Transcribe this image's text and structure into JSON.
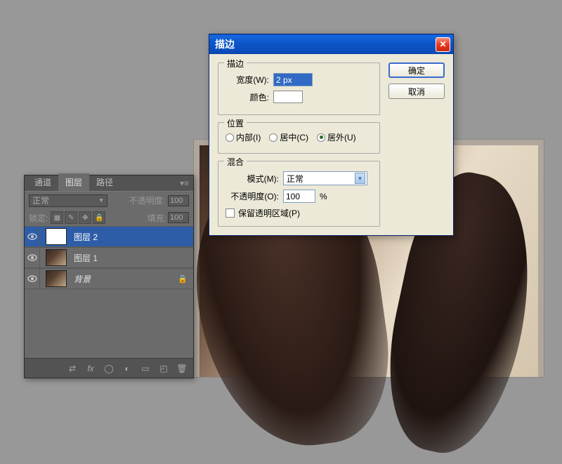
{
  "canvas": {},
  "layers_panel": {
    "tabs": {
      "channels": "通道",
      "layers": "图层",
      "paths": "路径"
    },
    "blend_mode": "正常",
    "opacity_label": "不透明度:",
    "opacity_value": "100",
    "lock_label": "锁定:",
    "fill_label": "填充:",
    "fill_value": "100",
    "layers": [
      {
        "name": "图层 2"
      },
      {
        "name": "图层 1"
      },
      {
        "name": "背景"
      }
    ],
    "footer_icons": [
      "link",
      "fx",
      "mask",
      "adjust",
      "group",
      "new",
      "trash"
    ]
  },
  "stroke_dialog": {
    "title": "描边",
    "ok": "确定",
    "cancel": "取消",
    "group_stroke": {
      "legend": "描边",
      "width_label": "宽度(W):",
      "width_value": "2 px",
      "color_label": "颜色:"
    },
    "group_position": {
      "legend": "位置",
      "inside": "内部(I)",
      "center": "居中(C)",
      "outside": "居外(U)"
    },
    "group_blend": {
      "legend": "混合",
      "mode_label": "模式(M):",
      "mode_value": "正常",
      "opacity_label": "不透明度(O):",
      "opacity_value": "100",
      "opacity_unit": "%",
      "preserve_label": "保留透明区域(P)"
    }
  }
}
